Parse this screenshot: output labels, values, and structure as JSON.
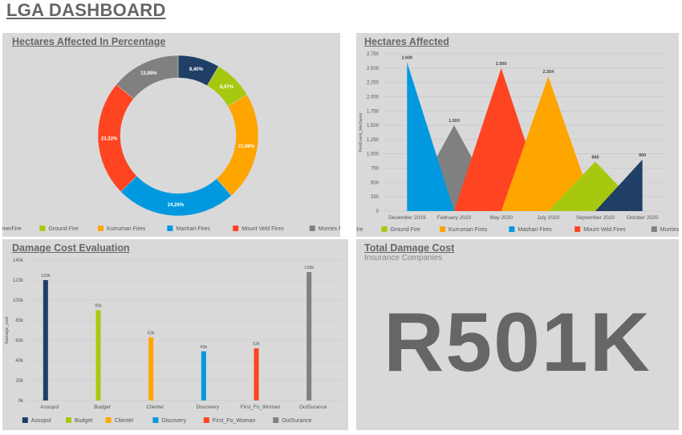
{
  "dashboard_title": "LGA DASHBOARD",
  "colors": {
    "Cape SummerFire": "#1f3f66",
    "Ground Fire": "#a6c90f",
    "Kurruman Fires": "#ffa500",
    "Mashari Fires": "#0099e0",
    "Mount Veld Fires": "#ff4422",
    "Murries Fires": "#808080"
  },
  "cost_colors": [
    "#1f3f66",
    "#a6c90f",
    "#ffa500",
    "#0099e0",
    "#ff4422",
    "#808080"
  ],
  "panels": {
    "donut": {
      "title": "Hectares Affected In Percentage"
    },
    "area": {
      "title": "Hectares Affected"
    },
    "bars": {
      "title": "Damage Cost Evaluation"
    },
    "total": {
      "title": "Total Damage Cost",
      "subtitle": "Insurance Companies",
      "value": "R501K"
    }
  },
  "chart_data": [
    {
      "type": "pie",
      "title": "Hectares Affected In Percentage",
      "labels": [
        "Cape SummerFire",
        "Ground Fire",
        "Kurruman Fires",
        "Mashari Fires",
        "Mount Veld Fires",
        "Murries Fires"
      ],
      "values": [
        8.4,
        8.07,
        21.96,
        24.26,
        23.32,
        13.99
      ],
      "value_labels": [
        "8,40%",
        "8,07%",
        "21,96%",
        "24,26%",
        "23,32%",
        "13,99%"
      ],
      "legend": "bottom"
    },
    {
      "type": "area",
      "title": "Hectares Affected",
      "ylabel": "FireEvent_Hectares",
      "x": [
        "December 2019",
        "February 2020",
        "May 2020",
        "July 2020",
        "September 2020",
        "October 2020"
      ],
      "ylim": [
        0,
        2750
      ],
      "yticks": [
        0,
        250,
        500,
        750,
        1000,
        1250,
        1500,
        1750,
        2000,
        2250,
        2500,
        2750
      ],
      "ytick_labels": [
        "0",
        "250",
        "500",
        "750",
        "1.000",
        "1.250",
        "1.500",
        "1.750",
        "2.000",
        "2.250",
        "2.500",
        "2.750"
      ],
      "series": [
        {
          "name": "Mashari Fires",
          "peak_index": 0,
          "value": 2600,
          "label": "2.600"
        },
        {
          "name": "Murries Fires",
          "peak_index": 1,
          "value": 1500,
          "label": "1.500"
        },
        {
          "name": "Mount Veld Fires",
          "peak_index": 2,
          "value": 2500,
          "label": "2.500"
        },
        {
          "name": "Kurruman Fires",
          "peak_index": 3,
          "value": 2354,
          "label": "2.354"
        },
        {
          "name": "Ground Fire",
          "peak_index": 4,
          "value": 865,
          "label": "865"
        },
        {
          "name": "Cape SummerFire",
          "peak_index": 5,
          "value": 900,
          "label": "900"
        }
      ],
      "legend": "bottom",
      "legend_items": [
        "Cape SummerFire",
        "Ground Fire",
        "Kurruman Fires",
        "Mashari Fires",
        "Mount Veld Fires",
        "Murries Fires"
      ],
      "grid": true
    },
    {
      "type": "bar",
      "title": "Damage Cost Evaluation",
      "ylabel": "Damage_cost",
      "categories": [
        "Assopol",
        "Budget",
        "Clientel",
        "Discovery",
        "First_Fo_Woman",
        "OutSurance"
      ],
      "values": [
        120000,
        90000,
        63000,
        49000,
        52000,
        128000
      ],
      "value_labels": [
        "120k",
        "90k",
        "63k",
        "49k",
        "52k",
        "128k"
      ],
      "ylim": [
        0,
        140000
      ],
      "yticks": [
        0,
        20000,
        40000,
        60000,
        80000,
        100000,
        120000,
        140000
      ],
      "ytick_labels": [
        "0k",
        "20k",
        "40k",
        "60k",
        "80k",
        "100k",
        "120k",
        "140k"
      ],
      "legend": "bottom",
      "grid": true
    }
  ]
}
